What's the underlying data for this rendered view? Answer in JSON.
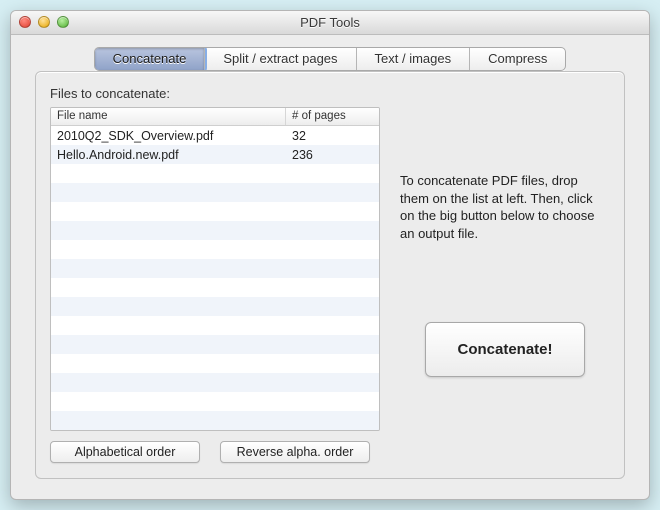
{
  "window": {
    "title": "PDF Tools"
  },
  "tabs": {
    "items": [
      {
        "label": "Concatenate",
        "active": true
      },
      {
        "label": "Split / extract pages",
        "active": false
      },
      {
        "label": "Text / images",
        "active": false
      },
      {
        "label": "Compress",
        "active": false
      }
    ]
  },
  "section": {
    "label": "Files to concatenate:"
  },
  "table": {
    "columns": {
      "col1": "File name",
      "col2": "# of pages"
    },
    "rows": [
      {
        "filename": "2010Q2_SDK_Overview.pdf",
        "pages": "32"
      },
      {
        "filename": "Hello.Android.new.pdf",
        "pages": "236"
      }
    ],
    "blank_rows": 15
  },
  "sort": {
    "alpha": "Alphabetical order",
    "reverse": "Reverse alpha. order"
  },
  "instructions": "To concatenate PDF files, drop them on the list at left. Then, click on the big button below to choose an output file.",
  "action": {
    "concatenate": "Concatenate!"
  }
}
